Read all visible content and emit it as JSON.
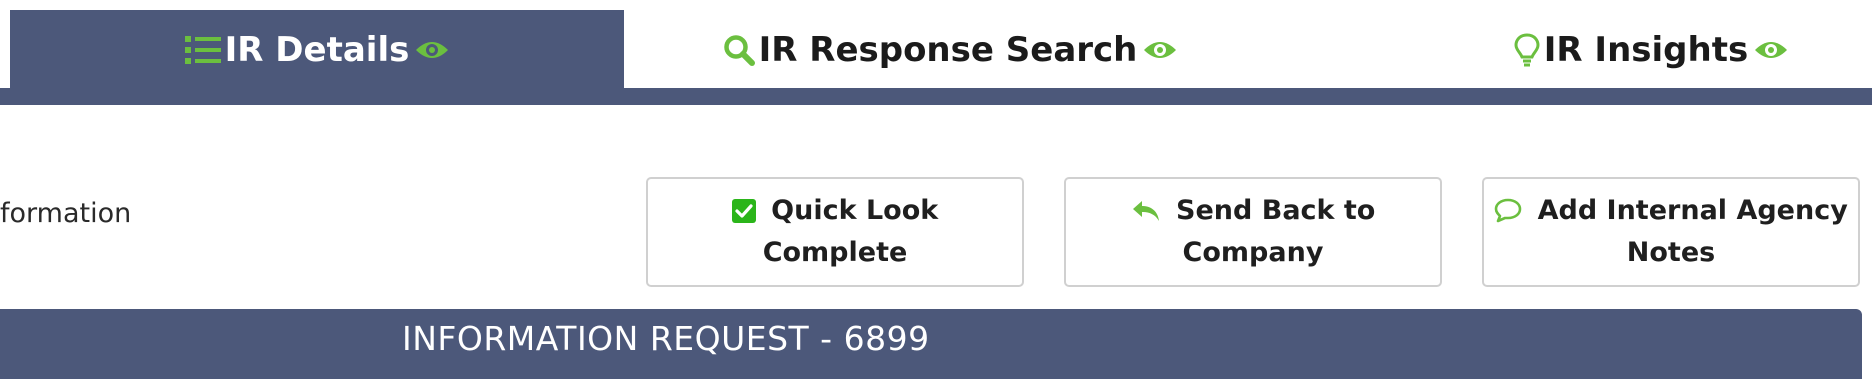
{
  "tabs": [
    {
      "label": "IR Details",
      "icon": "list-icon",
      "status_icon": "eye-icon",
      "active": true
    },
    {
      "label": "IR Response Search",
      "icon": "search-icon",
      "status_icon": "eye-icon",
      "active": false
    },
    {
      "label": "IR Insights",
      "icon": "lightbulb-icon",
      "status_icon": "eye-icon",
      "active": false
    }
  ],
  "section_label": "formation",
  "actions": [
    {
      "label_line1": "Quick Look",
      "label_line2": "Complete",
      "icon": "checkbox-checked-icon"
    },
    {
      "label_line1": "Send Back to",
      "label_line2": "Company",
      "icon": "reply-arrow-icon"
    },
    {
      "label_line1": "Add Internal Agency",
      "label_line2": "Notes",
      "icon": "comment-icon"
    }
  ],
  "banner": {
    "title": "INFORMATION REQUEST - 6899"
  },
  "colors": {
    "accent_green": "#6bbf3f",
    "header_navy": "#4c587a",
    "text": "#1f1f1f"
  }
}
